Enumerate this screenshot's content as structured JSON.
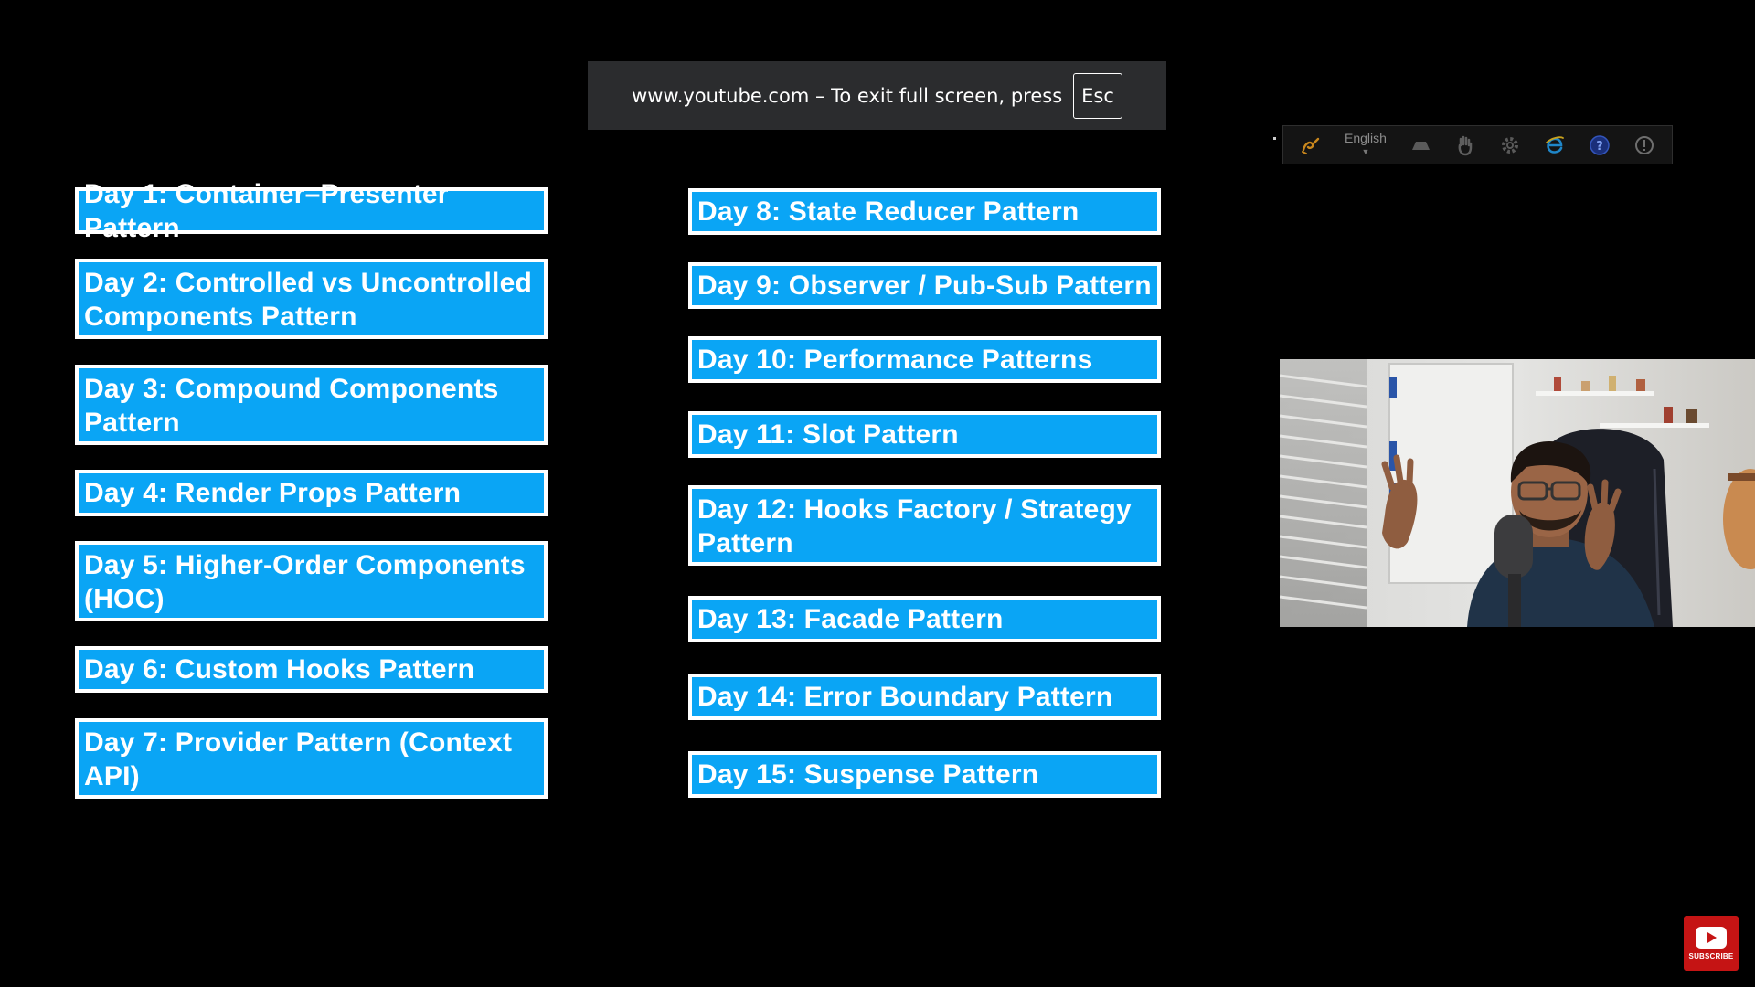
{
  "fullscreen_notice": {
    "message": "www.youtube.com – To exit full screen, press",
    "key": "Esc"
  },
  "patterns_left": [
    {
      "label": "Day 1: Container–Presenter Pattern"
    },
    {
      "label": "Day 2: Controlled vs Uncontrolled Components Pattern"
    },
    {
      "label": "Day 3: Compound Components Pattern"
    },
    {
      "label": "Day 4: Render Props Pattern"
    },
    {
      "label": "Day 5: Higher-Order Components (HOC)"
    },
    {
      "label": "Day 6: Custom Hooks Pattern"
    },
    {
      "label": "Day 7: Provider Pattern (Context API)"
    }
  ],
  "patterns_right": [
    {
      "label": "Day 8: State Reducer Pattern"
    },
    {
      "label": "Day 9: Observer / Pub-Sub Pattern"
    },
    {
      "label": "Day 10: Performance Patterns"
    },
    {
      "label": "Day 11: Slot Pattern"
    },
    {
      "label": "Day 12: Hooks Factory / Strategy Pattern"
    },
    {
      "label": "Day 13: Facade Pattern"
    },
    {
      "label": "Day 14: Error Boundary Pattern"
    },
    {
      "label": "Day 15: Suspense Pattern"
    }
  ],
  "toolbar": {
    "language": "English",
    "icons": [
      "screen-draw-icon",
      "language-selector",
      "eraser-icon",
      "hand-pointer-icon",
      "settings-gear-icon",
      "browser-icon",
      "help-icon",
      "info-icon"
    ]
  },
  "subscribe": {
    "label": "SUBSCRIBE"
  },
  "colors": {
    "card_fill": "#0aa5f5",
    "card_border": "#ffffff",
    "background": "#000000",
    "subscribe_red": "#c51414"
  }
}
